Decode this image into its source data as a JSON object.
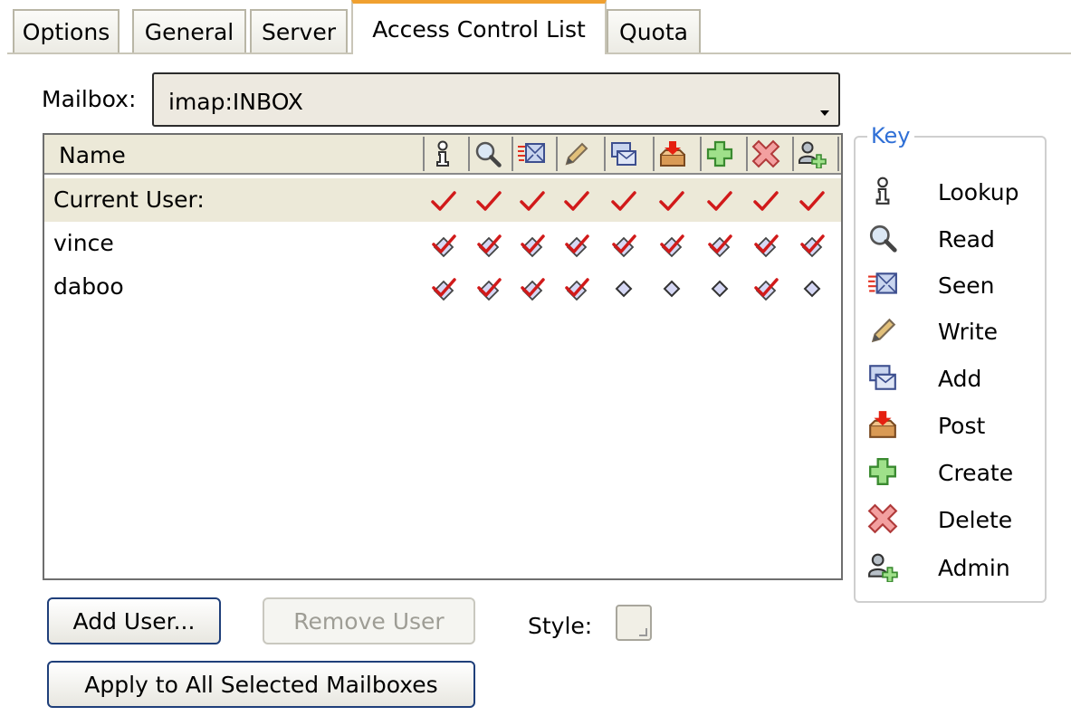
{
  "tabs": [
    {
      "label": "Options"
    },
    {
      "label": "General"
    },
    {
      "label": "Server"
    },
    {
      "label": "Access Control List",
      "active": true
    },
    {
      "label": "Quota"
    }
  ],
  "mailbox": {
    "label": "Mailbox:",
    "value": "imap:INBOX"
  },
  "table": {
    "name_header": "Name",
    "rights_icons": [
      "lookup-icon",
      "read-icon",
      "seen-icon",
      "write-icon",
      "add-icon",
      "post-icon",
      "create-icon",
      "delete-icon",
      "admin-icon"
    ],
    "rows": [
      {
        "name": "Current User:",
        "selected": true,
        "rights": [
          "check",
          "check",
          "check",
          "check",
          "check",
          "check",
          "check",
          "check",
          "check"
        ]
      },
      {
        "name": "vince",
        "selected": false,
        "rights": [
          "box-check",
          "box-check",
          "box-check",
          "box-check",
          "box-check",
          "box-check",
          "box-check",
          "box-check",
          "box-check"
        ]
      },
      {
        "name": "daboo",
        "selected": false,
        "rights": [
          "box-check",
          "box-check",
          "box-check",
          "box-check",
          "diamond",
          "diamond",
          "diamond",
          "box-check",
          "diamond"
        ]
      }
    ]
  },
  "key": {
    "title": "Key",
    "items": [
      {
        "icon": "lookup-icon",
        "label": "Lookup"
      },
      {
        "icon": "read-icon",
        "label": "Read"
      },
      {
        "icon": "seen-icon",
        "label": "Seen"
      },
      {
        "icon": "write-icon",
        "label": "Write"
      },
      {
        "icon": "add-icon",
        "label": "Add"
      },
      {
        "icon": "post-icon",
        "label": "Post"
      },
      {
        "icon": "create-icon",
        "label": "Create"
      },
      {
        "icon": "delete-icon",
        "label": "Delete"
      },
      {
        "icon": "admin-icon",
        "label": "Admin"
      }
    ]
  },
  "buttons": {
    "add_user": "Add User...",
    "remove_user": "Remove User",
    "apply_all": "Apply to All Selected Mailboxes"
  },
  "style": {
    "label": "Style:"
  },
  "colors": {
    "accent_tab": "#f0a030",
    "key_title": "#2f6fd6",
    "check_red": "#d11a1a",
    "selected_row": "#ece9d8"
  }
}
